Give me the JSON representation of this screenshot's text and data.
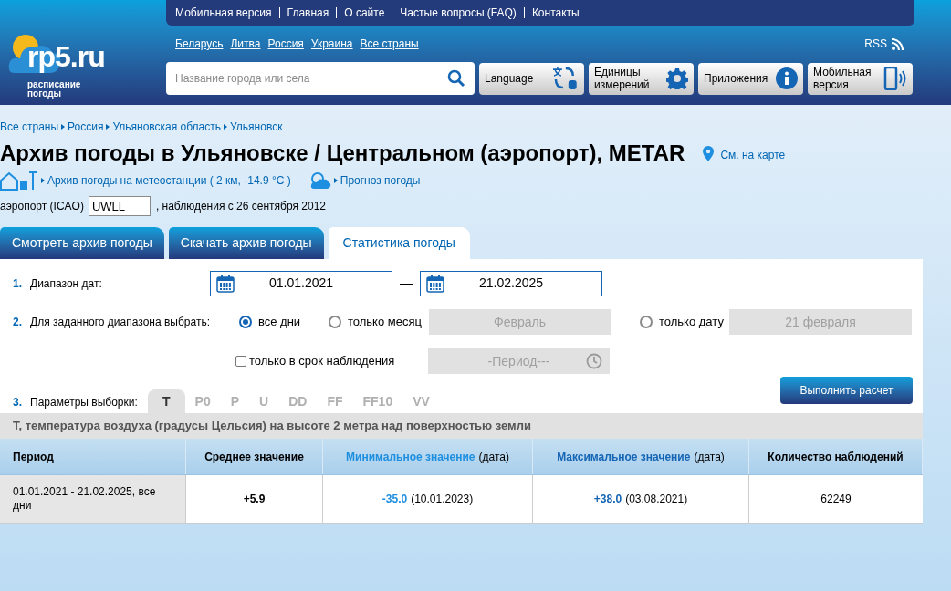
{
  "logo": {
    "name": "rp5.ru",
    "tagline_1": "расписание",
    "tagline_2": "погоды"
  },
  "top_nav": [
    "Мобильная версия",
    "Главная",
    "О сайте",
    "Частые вопросы (FAQ)",
    "Контакты"
  ],
  "countries": [
    "Беларусь",
    "Литва",
    "Россия",
    "Украина",
    "Все страны"
  ],
  "rss": "RSS",
  "search": {
    "placeholder": "Название города или села"
  },
  "tool_buttons": [
    {
      "label": "Language",
      "kind": "language"
    },
    {
      "label": "Единицы измерений",
      "kind": "settings"
    },
    {
      "label": "Приложения",
      "kind": "info"
    },
    {
      "label": "Мобильная версия",
      "kind": "mobile"
    }
  ],
  "breadcrumbs": [
    "Все страны",
    "Россия",
    "Ульяновская область",
    "Ульяновск"
  ],
  "title": "Архив погоды в Ульяновске / Центральном (аэропорт), METAR",
  "map_link": "См. на карте",
  "station_link": "Архив погоды на метеостанции ( 2 км, -14.9 °C )",
  "forecast_link": "Прогноз погоды",
  "icao": {
    "label": "аэропорт (ICAO)",
    "value": "UWLL",
    "note": ", наблюдения с 26 сентября 2012"
  },
  "tabs": [
    {
      "label": "Смотреть архив погоды",
      "selected": false
    },
    {
      "label": "Скачать архив погоды",
      "selected": false
    },
    {
      "label": "Статистика погоды",
      "selected": true
    }
  ],
  "form": {
    "date_range": {
      "number": "1.",
      "label": "Диапазон дат:",
      "from": "01.01.2021",
      "dash": "—",
      "to": "21.02.2025"
    },
    "choose": {
      "number": "2.",
      "label": "Для заданного диапазона выбрать:",
      "options": [
        {
          "label": "все дни",
          "selected": true
        },
        {
          "label": "только месяц",
          "selected": false
        },
        {
          "label": "только дату",
          "selected": false
        }
      ],
      "month": {
        "value": "Февраль",
        "disabled": true
      },
      "date": {
        "value": "21 февраля",
        "disabled": true
      }
    },
    "observation_only": {
      "label": "только в срок наблюдения",
      "checked": false
    },
    "period": {
      "value": "-Период---",
      "disabled": true
    },
    "params": {
      "number": "3.",
      "label": "Параметры выборки:",
      "items": [
        {
          "label": "T",
          "selected": true
        },
        {
          "label": "P0",
          "selected": false
        },
        {
          "label": "P",
          "selected": false
        },
        {
          "label": "U",
          "selected": false
        },
        {
          "label": "DD",
          "selected": false
        },
        {
          "label": "FF",
          "selected": false
        },
        {
          "label": "FF10",
          "selected": false
        },
        {
          "label": "VV",
          "selected": false
        }
      ]
    },
    "submit": "Выполнить расчет"
  },
  "description": "T, температура воздуха (градусы Цельсия) на высоте 2 метра над поверхностью земли",
  "table": {
    "columns": [
      {
        "label": "Период"
      },
      {
        "label": "Среднее значение"
      },
      {
        "label": "Минимальное значение",
        "suffix": "(дата)",
        "color": "#1e8fe0"
      },
      {
        "label": "Максимальное значение",
        "suffix": "(дата)",
        "color": "#1565b5"
      },
      {
        "label": "Количество наблюдений"
      }
    ],
    "rows": [
      {
        "period": "01.01.2021 - 21.02.2025, все дни",
        "mean": "+5.9",
        "min": "-35.0",
        "min_date": "(10.01.2023)",
        "max": "+38.0",
        "max_date": "(03.08.2021)",
        "count": "62249"
      }
    ]
  }
}
